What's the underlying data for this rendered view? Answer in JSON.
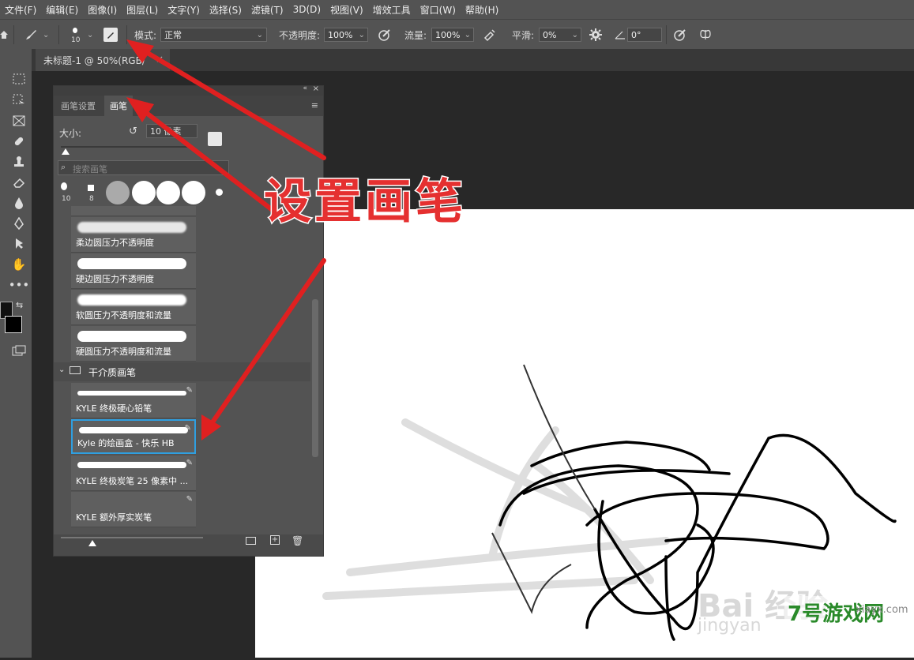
{
  "menubar": [
    "文件(F)",
    "编辑(E)",
    "图像(I)",
    "图层(L)",
    "文字(Y)",
    "选择(S)",
    "滤镜(T)",
    "3D(D)",
    "视图(V)",
    "增效工具",
    "窗口(W)",
    "帮助(H)"
  ],
  "options": {
    "brush_size": "10",
    "mode_label": "模式:",
    "mode_value": "正常",
    "opacity_label": "不透明度:",
    "opacity_value": "100%",
    "flow_label": "流量:",
    "flow_value": "100%",
    "smooth_label": "平滑:",
    "smooth_value": "0%",
    "angle_value": "0°"
  },
  "document": {
    "tab_title": "未标题-1 @ 50%(RGB/",
    "close": "×"
  },
  "panel": {
    "tab_settings": "画笔设置",
    "tab_brushes": "画笔",
    "size_label": "大小:",
    "size_value": "10 像素",
    "search_placeholder": "搜索画笔",
    "presets": [
      "10",
      "8"
    ],
    "brushes": [
      "柔边圆压力不透明度",
      "硬边圆压力不透明度",
      "软圆压力不透明度和流量",
      "硬圆压力不透明度和流量"
    ],
    "group_name": "干介质画笔",
    "dry_brushes": [
      "KYLE 终极硬心铅笔",
      "Kyle 的绘画盒 - 快乐 HB",
      "KYLE 终极炭笔 25 像素中 ...",
      "KYLE 额外厚实炭笔"
    ]
  },
  "annotation": {
    "text": "设置画笔",
    "color": "#e53030"
  },
  "watermark": {
    "site": "jingyan",
    "brand": "7号游戏网",
    "url": "xiayx.com"
  }
}
